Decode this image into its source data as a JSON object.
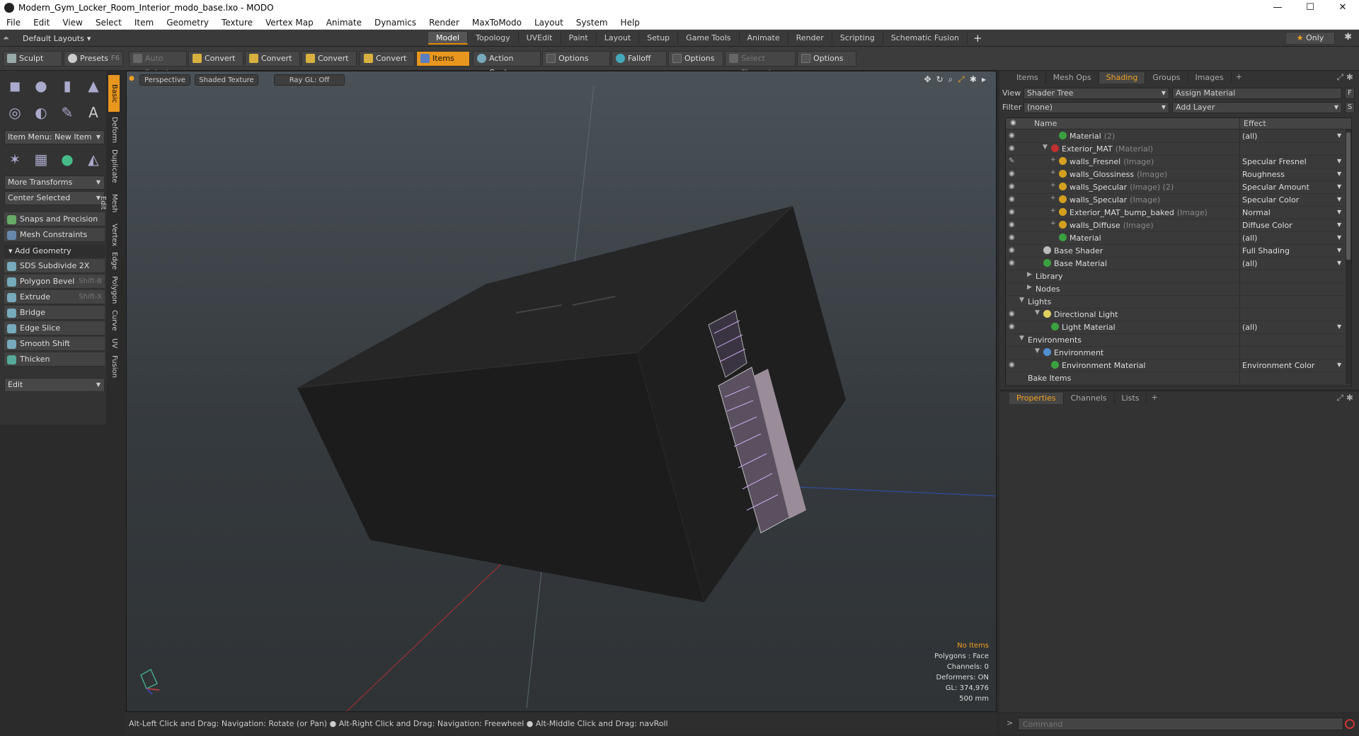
{
  "window": {
    "title": "Modern_Gym_Locker_Room_Interior_modo_base.lxo - MODO",
    "controls": [
      "—",
      "☐",
      "✕"
    ]
  },
  "menu": [
    "File",
    "Edit",
    "View",
    "Select",
    "Item",
    "Geometry",
    "Texture",
    "Vertex Map",
    "Animate",
    "Dynamics",
    "Render",
    "MaxToModo",
    "Layout",
    "System",
    "Help"
  ],
  "layouts": {
    "label": "Default Layouts",
    "arrow": "▾"
  },
  "tabs": [
    {
      "label": "Model",
      "active": true
    },
    {
      "label": "Topology"
    },
    {
      "label": "UVEdit"
    },
    {
      "label": "Paint"
    },
    {
      "label": "Layout"
    },
    {
      "label": "Setup"
    },
    {
      "label": "Game Tools"
    },
    {
      "label": "Animate"
    },
    {
      "label": "Render"
    },
    {
      "label": "Scripting"
    },
    {
      "label": "Schematic Fusion"
    }
  ],
  "tab_add": "+",
  "only_label": "Only",
  "toolbar": {
    "sculpt": "Sculpt",
    "presets": "Presets",
    "presets_key": "F6",
    "auto_select": "Auto Select",
    "convert1": "Convert",
    "convert2": "Convert",
    "convert3": "Convert",
    "convert4": "Convert",
    "items": "Items",
    "action_center": "Action Center",
    "options1": "Options",
    "falloff": "Falloff",
    "options2": "Options",
    "select_through": "Select Through",
    "options3": "Options"
  },
  "left": {
    "item_menu": "Item Menu: New Item",
    "more_transforms": "More Transforms",
    "center_selected": "Center Selected",
    "snaps": "Snaps and Precision",
    "mesh_constraints": "Mesh Constraints",
    "add_geometry": "Add Geometry",
    "sds": "SDS Subdivide 2X",
    "polygon_bevel": "Polygon Bevel",
    "polygon_bevel_key": "Shift-B",
    "extrude": "Extrude",
    "extrude_key": "Shift-X",
    "bridge": "Bridge",
    "edge_slice": "Edge Slice",
    "smooth_shift": "Smooth Shift",
    "thicken": "Thicken",
    "edit": "Edit"
  },
  "vtabs": [
    "Basic",
    "Deform",
    "Duplicate",
    "Mesh Edit",
    "Vertex",
    "Edge",
    "Polygon",
    "Curve",
    "UV",
    "Fusion"
  ],
  "viewport": {
    "perspective": "Perspective",
    "shaded_texture": "Shaded Texture",
    "ray_gl": "Ray GL: Off",
    "info": {
      "no_items": "No Items",
      "polygons": "Polygons : Face",
      "channels": "Channels: 0",
      "deformers": "Deformers: ON",
      "gl": "GL: 374,976",
      "scale": "500 mm"
    }
  },
  "status": "Alt-Left Click and Drag: Navigation: Rotate (or Pan) ● Alt-Right Click and Drag: Navigation: Freewheel ● Alt-Middle Click and Drag: navRoll",
  "command": {
    "prompt": ">",
    "placeholder": "Command"
  },
  "right": {
    "tabs": [
      {
        "label": "Items"
      },
      {
        "label": "Mesh Ops"
      },
      {
        "label": "Shading",
        "active": true
      },
      {
        "label": "Groups"
      },
      {
        "label": "Images"
      }
    ],
    "view_label": "View",
    "view_value": "Shader Tree",
    "assign_material": "Assign Material",
    "f_key": "F",
    "filter_label": "Filter",
    "filter_value": "(none)",
    "add_layer": "Add Layer",
    "s_key": "S",
    "col_name": "Name",
    "col_effect": "Effect",
    "rows": [
      {
        "indent": 5,
        "name": "Material",
        "type": "(2)",
        "effect": "(all)",
        "dot": "#3aa040",
        "eye": true
      },
      {
        "indent": 4,
        "name": "Exterior_MAT",
        "type": "(Material)",
        "effect": "",
        "dot": "#c03030",
        "eye": true,
        "exp": "▼"
      },
      {
        "indent": 5,
        "name": "walls_Fresnel",
        "type": "(Image)",
        "effect": "Specular Fresnel",
        "dot": "#d4a020",
        "eye": false,
        "brush": true,
        "exp": "+"
      },
      {
        "indent": 5,
        "name": "walls_Glossiness",
        "type": "(Image)",
        "effect": "Roughness",
        "dot": "#d4a020",
        "eye": true,
        "exp": "+"
      },
      {
        "indent": 5,
        "name": "walls_Specular",
        "type": "(Image) (2)",
        "effect": "Specular Amount",
        "dot": "#d4a020",
        "eye": true,
        "exp": "+"
      },
      {
        "indent": 5,
        "name": "walls_Specular",
        "type": "(Image)",
        "effect": "Specular Color",
        "dot": "#d4a020",
        "eye": true,
        "exp": "+"
      },
      {
        "indent": 5,
        "name": "Exterior_MAT_bump_baked",
        "type": "(Image)",
        "effect": "Normal",
        "dot": "#d4a020",
        "eye": true,
        "exp": "+"
      },
      {
        "indent": 5,
        "name": "walls_Diffuse",
        "type": "(Image)",
        "effect": "Diffuse Color",
        "dot": "#d4a020",
        "eye": true,
        "exp": "+"
      },
      {
        "indent": 5,
        "name": "Material",
        "type": "",
        "effect": "(all)",
        "dot": "#3aa040",
        "eye": true
      },
      {
        "indent": 3,
        "name": "Base Shader",
        "type": "",
        "effect": "Full Shading",
        "dot": "#bbbbbb",
        "eye": true
      },
      {
        "indent": 3,
        "name": "Base Material",
        "type": "",
        "effect": "(all)",
        "dot": "#3aa040",
        "eye": true
      },
      {
        "indent": 2,
        "name": "Library",
        "type": "",
        "effect": "",
        "dot": "",
        "eye": false,
        "exp": "▶"
      },
      {
        "indent": 2,
        "name": "Nodes",
        "type": "",
        "effect": "",
        "dot": "",
        "eye": false,
        "exp": "▶"
      },
      {
        "indent": 1,
        "name": "Lights",
        "type": "",
        "effect": "",
        "dot": "",
        "eye": false,
        "exp": "▼"
      },
      {
        "indent": 3,
        "name": "Directional Light",
        "type": "",
        "effect": "",
        "dot": "#e0d060",
        "eye": true,
        "exp": "▼"
      },
      {
        "indent": 4,
        "name": "Light Material",
        "type": "",
        "effect": "(all)",
        "dot": "#3aa040",
        "eye": true
      },
      {
        "indent": 1,
        "name": "Environments",
        "type": "",
        "effect": "",
        "dot": "",
        "eye": false,
        "exp": "▼"
      },
      {
        "indent": 3,
        "name": "Environment",
        "type": "",
        "effect": "",
        "dot": "#5090d0",
        "eye": false,
        "exp": "▼"
      },
      {
        "indent": 4,
        "name": "Environment Material",
        "type": "",
        "effect": "Environment Color",
        "dot": "#3aa040",
        "eye": true
      },
      {
        "indent": 1,
        "name": "Bake Items",
        "type": "",
        "effect": "",
        "dot": "",
        "eye": false
      }
    ],
    "prop_tabs": [
      {
        "label": "Properties",
        "active": true
      },
      {
        "label": "Channels"
      },
      {
        "label": "Lists"
      }
    ]
  }
}
